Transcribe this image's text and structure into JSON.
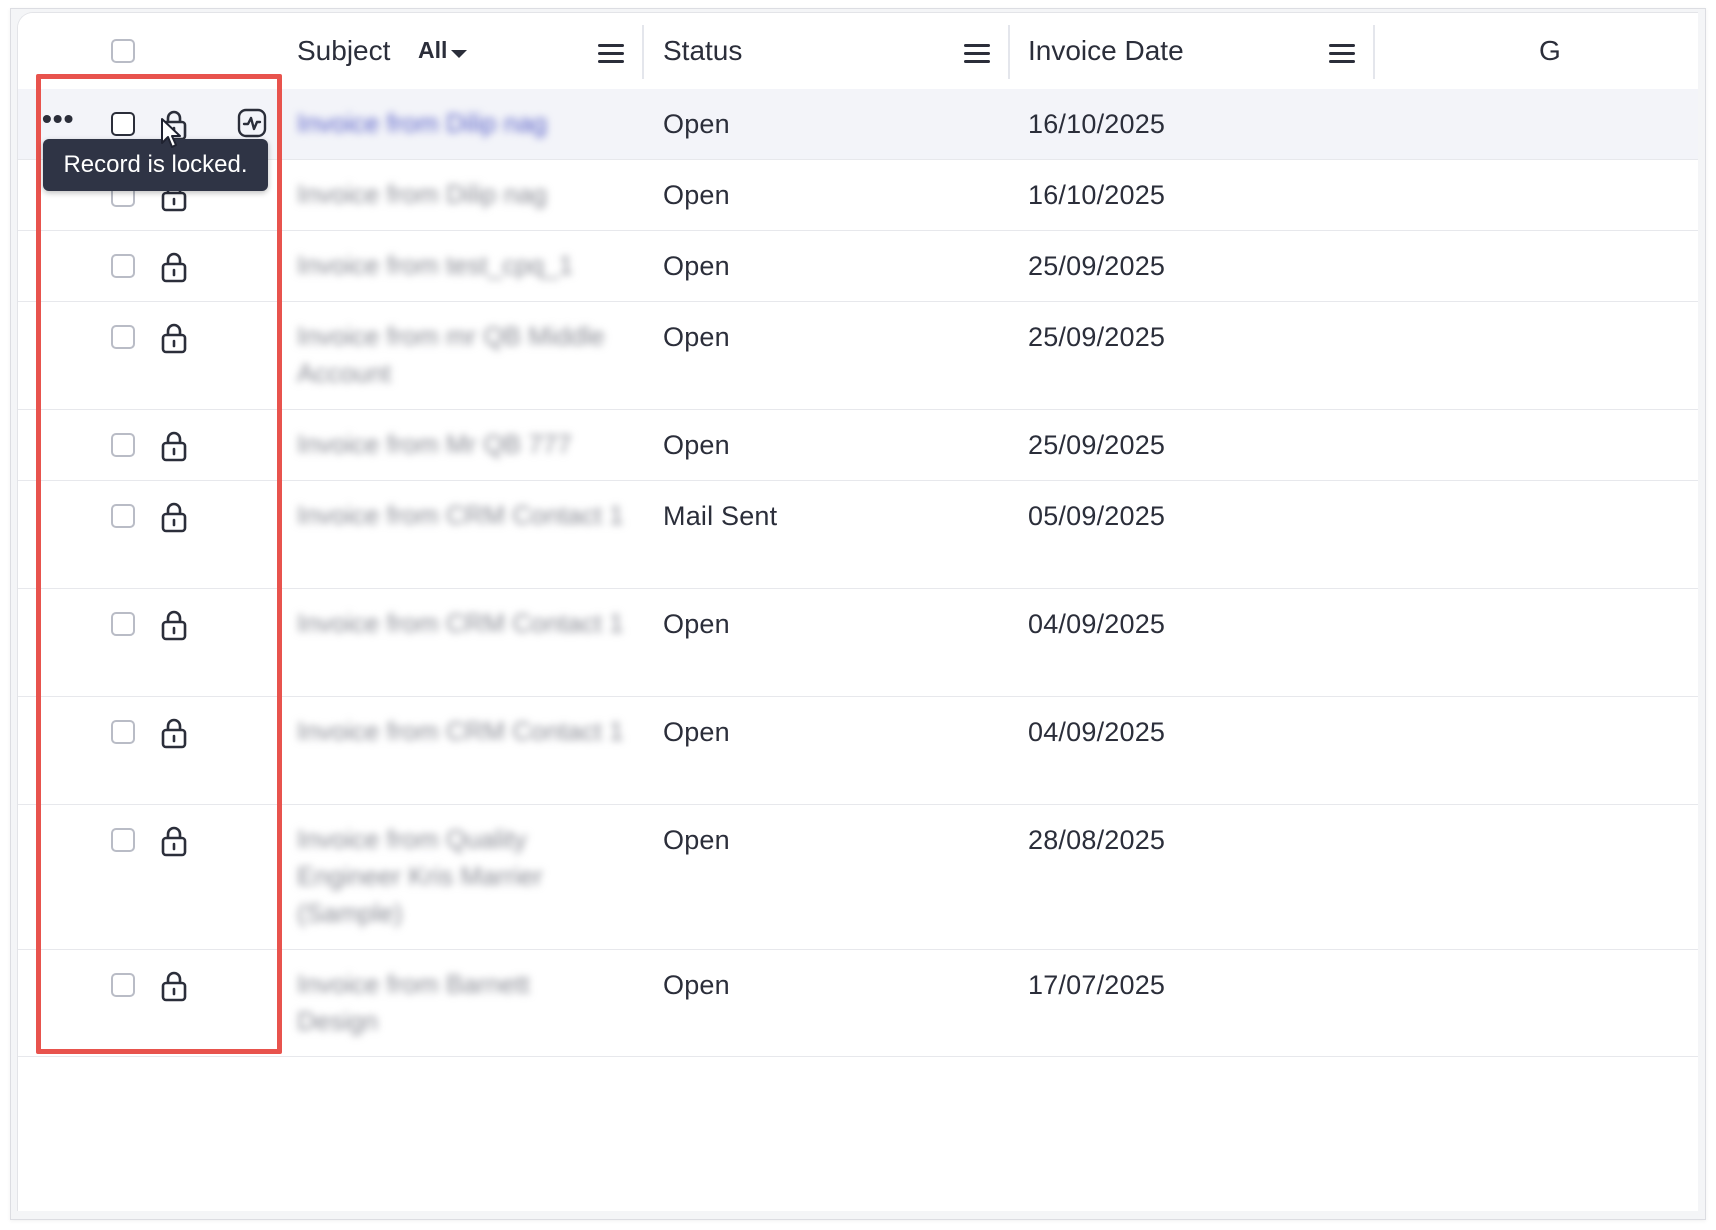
{
  "table": {
    "columns": [
      {
        "label": "Subject",
        "filter": "All"
      },
      {
        "label": "Status"
      },
      {
        "label": "Invoice Date"
      },
      {
        "label": "G"
      }
    ],
    "rows": [
      {
        "subject": "Invoice from Dilip nag",
        "status": "Open",
        "invoice_date": "16/10/2025"
      },
      {
        "subject": "Invoice from Dilip nag",
        "status": "Open",
        "invoice_date": "16/10/2025"
      },
      {
        "subject": "Invoice from test_cpq_1",
        "status": "Open",
        "invoice_date": "25/09/2025"
      },
      {
        "subject": "Invoice from mr QB Middle Account",
        "status": "Open",
        "invoice_date": "25/09/2025"
      },
      {
        "subject": "Invoice from Mr QB 777",
        "status": "Open",
        "invoice_date": "25/09/2025"
      },
      {
        "subject": "Invoice from CRM Contact 1",
        "status": "Mail Sent",
        "invoice_date": "05/09/2025"
      },
      {
        "subject": "Invoice from CRM Contact 1",
        "status": "Open",
        "invoice_date": "04/09/2025"
      },
      {
        "subject": "Invoice from CRM Contact 1",
        "status": "Open",
        "invoice_date": "04/09/2025"
      },
      {
        "subject": "Invoice from Quality Engineer Kris Marrier (Sample)",
        "status": "Open",
        "invoice_date": "28/08/2025"
      },
      {
        "subject": "Invoice from Barnett Design",
        "status": "Open",
        "invoice_date": "17/07/2025"
      }
    ]
  },
  "tooltip": {
    "text": "Record is locked."
  },
  "row_actions": {
    "more_label": "•••"
  },
  "icons": {
    "lock": "lock-icon",
    "activity": "activity-icon",
    "menu": "column-menu-icon",
    "more": "more-dots-icon",
    "caret": "caret-down-icon"
  },
  "colors": {
    "highlight_box": "#e8534d",
    "tooltip_bg": "#2f3445",
    "link": "#5c64c9"
  }
}
